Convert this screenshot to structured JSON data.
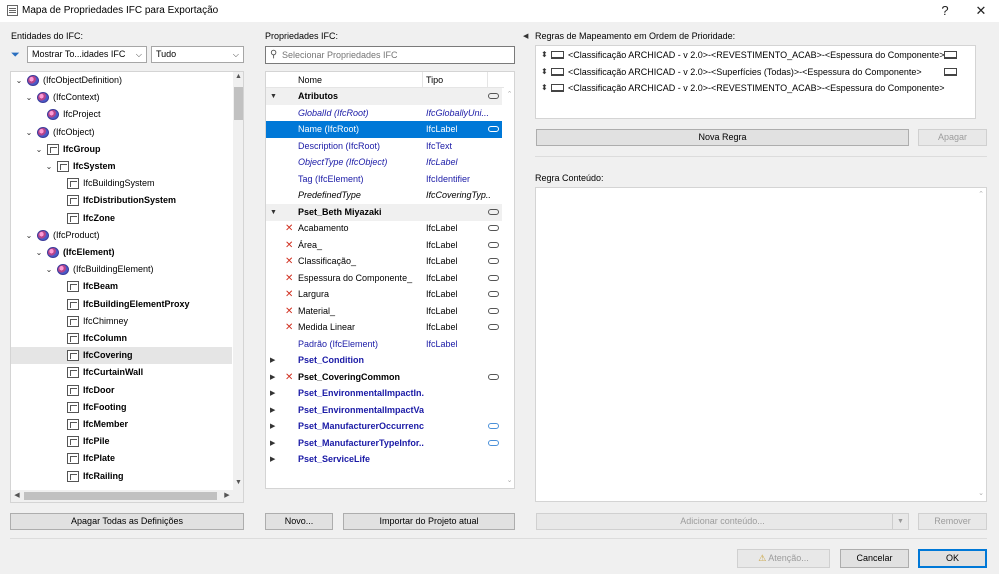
{
  "window": {
    "title": "Mapa de Propriedades IFC para Exportação",
    "help": "?",
    "close": "✕"
  },
  "left": {
    "heading": "Entidades do IFC:",
    "filter_value": "Mostrar To...idades IFC",
    "scope_value": "Tudo",
    "tree": [
      {
        "label": "(IfcObjectDefinition)",
        "bold": false,
        "icon": "ifc-definition-icon",
        "expanded": true
      },
      {
        "label": "(IfcContext)",
        "bold": false,
        "icon": "ifc-definition-icon",
        "expanded": true
      },
      {
        "label": "IfcProject",
        "bold": false,
        "icon": "ifc-definition-icon",
        "expanded": null
      },
      {
        "label": "(IfcObject)",
        "bold": false,
        "icon": "ifc-definition-icon",
        "expanded": true
      },
      {
        "label": "IfcGroup",
        "bold": true,
        "icon": "group-icon",
        "expanded": true
      },
      {
        "label": "IfcSystem",
        "bold": true,
        "icon": "system-icon",
        "expanded": true
      },
      {
        "label": "IfcBuildingSystem",
        "bold": false,
        "icon": "building-system-icon",
        "expanded": null
      },
      {
        "label": "IfcDistributionSystem",
        "bold": true,
        "icon": "distribution-system-icon",
        "expanded": null
      },
      {
        "label": "IfcZone",
        "bold": true,
        "icon": "zone-icon",
        "expanded": null
      },
      {
        "label": "(IfcProduct)",
        "bold": false,
        "icon": "ifc-definition-icon",
        "expanded": true
      },
      {
        "label": "(IfcElement)",
        "bold": true,
        "icon": "ifc-definition-icon",
        "expanded": true
      },
      {
        "label": "(IfcBuildingElement)",
        "bold": false,
        "icon": "ifc-definition-icon",
        "expanded": true
      },
      {
        "label": "IfcBeam",
        "bold": true,
        "icon": "beam-icon",
        "expanded": null
      },
      {
        "label": "IfcBuildingElementProxy",
        "bold": true,
        "icon": "proxy-icon",
        "expanded": null
      },
      {
        "label": "IfcChimney",
        "bold": false,
        "icon": "chimney-icon",
        "expanded": null
      },
      {
        "label": "IfcColumn",
        "bold": true,
        "icon": "column-icon",
        "expanded": null
      },
      {
        "label": "IfcCovering",
        "bold": true,
        "icon": "covering-icon",
        "expanded": null,
        "selected": true
      },
      {
        "label": "IfcCurtainWall",
        "bold": true,
        "icon": "curtain-wall-icon",
        "expanded": null
      },
      {
        "label": "IfcDoor",
        "bold": true,
        "icon": "door-icon",
        "expanded": null
      },
      {
        "label": "IfcFooting",
        "bold": true,
        "icon": "footing-icon",
        "expanded": null
      },
      {
        "label": "IfcMember",
        "bold": true,
        "icon": "member-icon",
        "expanded": null
      },
      {
        "label": "IfcPile",
        "bold": true,
        "icon": "pile-icon",
        "expanded": null
      },
      {
        "label": "IfcPlate",
        "bold": true,
        "icon": "plate-icon",
        "expanded": null
      },
      {
        "label": "IfcRailing",
        "bold": true,
        "icon": "railing-icon",
        "expanded": null
      }
    ],
    "clear_button": "Apagar Todas as Definições"
  },
  "middle": {
    "heading": "Propriedades IFC:",
    "search_placeholder": "Selecionar Propriedades IFC",
    "col_name": "Nome",
    "col_type": "Tipo",
    "rows": [
      {
        "kind": "group",
        "name": "Atributos",
        "type": "",
        "expanded": true,
        "link": true
      },
      {
        "kind": "attr",
        "name": "GlobalId (IfcRoot)",
        "type": "IfcGloballyUni...",
        "style": "italic-navy"
      },
      {
        "kind": "attr",
        "name": "Name (IfcRoot)",
        "type": "IfcLabel",
        "style": "navy",
        "selected": true,
        "link": true
      },
      {
        "kind": "attr",
        "name": "Description (IfcRoot)",
        "type": "IfcText",
        "style": "navy"
      },
      {
        "kind": "attr",
        "name": "ObjectType (IfcObject)",
        "type": "IfcLabel",
        "style": "italic-navy"
      },
      {
        "kind": "attr",
        "name": "Tag (IfcElement)",
        "type": "IfcIdentifier",
        "style": "navy"
      },
      {
        "kind": "attr",
        "name": "PredefinedType",
        "type": "IfcCoveringTyp...",
        "style": "italic"
      },
      {
        "kind": "group",
        "name": "Pset_Beth Miyazaki",
        "type": "",
        "expanded": true,
        "link": true
      },
      {
        "kind": "prop",
        "name": "Acabamento",
        "type": "IfcLabel",
        "x": true,
        "link": true
      },
      {
        "kind": "prop",
        "name": "Área_",
        "type": "IfcLabel",
        "x": true,
        "link": true
      },
      {
        "kind": "prop",
        "name": "Classificação_",
        "type": "IfcLabel",
        "x": true,
        "link": true
      },
      {
        "kind": "prop",
        "name": "Espessura do Componente_",
        "type": "IfcLabel",
        "x": true,
        "link": true
      },
      {
        "kind": "prop",
        "name": "Largura",
        "type": "IfcLabel",
        "x": true,
        "link": true
      },
      {
        "kind": "prop",
        "name": "Material_",
        "type": "IfcLabel",
        "x": true,
        "link": true
      },
      {
        "kind": "prop",
        "name": "Medida Linear",
        "type": "IfcLabel",
        "x": true,
        "link": true
      },
      {
        "kind": "attr",
        "name": "Padrão (IfcElement)",
        "type": "IfcLabel",
        "style": "navy"
      },
      {
        "kind": "group",
        "name": "Pset_Condition",
        "type": "",
        "expanded": false,
        "style": "bluebold"
      },
      {
        "kind": "group",
        "name": "Pset_CoveringCommon",
        "type": "",
        "expanded": false,
        "x": true,
        "link": true
      },
      {
        "kind": "group",
        "name": "Pset_EnvironmentalImpactIn...",
        "type": "",
        "expanded": false,
        "style": "bluebold"
      },
      {
        "kind": "group",
        "name": "Pset_EnvironmentalImpactVa...",
        "type": "",
        "expanded": false,
        "style": "bluebold"
      },
      {
        "kind": "group",
        "name": "Pset_ManufacturerOccurrence",
        "type": "",
        "expanded": false,
        "style": "bluebold",
        "link": true,
        "link_blue": true
      },
      {
        "kind": "group",
        "name": "Pset_ManufacturerTypeInfor...",
        "type": "",
        "expanded": false,
        "style": "bluebold",
        "link": true,
        "link_blue": true
      },
      {
        "kind": "group",
        "name": "Pset_ServiceLife",
        "type": "",
        "expanded": false,
        "style": "bluebold"
      }
    ],
    "new_button": "Novo...",
    "import_button": "Importar do Projeto atual"
  },
  "right": {
    "heading": "Regras de Mapeamento em Ordem de Prioridade:",
    "rules": [
      {
        "text": "<Classificação ARCHICAD - v 2.0>-<REVESTIMENTO_ACAB>-<Espessura do Componente>",
        "end_icon": true
      },
      {
        "text": "<Classificação ARCHICAD - v 2.0>-<Superfícies (Todas)>-<Espessura do Componente>",
        "end_icon": true
      },
      {
        "text": "<Classificação ARCHICAD - v 2.0>-<REVESTIMENTO_ACAB>-<Espessura do Componente>",
        "end_icon": false
      }
    ],
    "new_rule_button": "Nova Regra",
    "delete_button": "Apagar",
    "content_heading": "Regra Conteúdo:",
    "add_content_button": "Adicionar conteúdo...",
    "remove_button": "Remover"
  },
  "footer": {
    "warning_button": "Atenção...",
    "cancel_button": "Cancelar",
    "ok_button": "OK"
  }
}
